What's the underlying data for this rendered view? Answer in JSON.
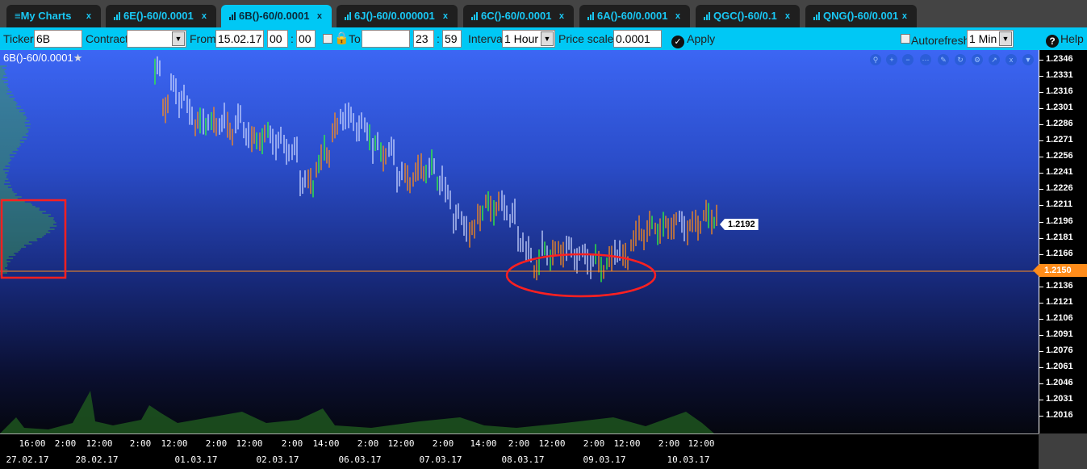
{
  "tabs": [
    {
      "label": "My Charts",
      "icon": "menu-icon"
    },
    {
      "label": "6E()-60/0.0001",
      "icon": "bar-chart-icon"
    },
    {
      "label": "6B()-60/0.0001",
      "icon": "bar-chart-icon",
      "active": true
    },
    {
      "label": "6J()-60/0.000001",
      "icon": "bar-chart-icon"
    },
    {
      "label": "6C()-60/0.0001",
      "icon": "bar-chart-icon"
    },
    {
      "label": "6A()-60/0.0001",
      "icon": "bar-chart-icon"
    },
    {
      "label": "QGC()-60/0.1",
      "icon": "bar-chart-icon"
    },
    {
      "label": "QNG()-60/0.001",
      "icon": "bar-chart-icon"
    }
  ],
  "close_symbol": "x",
  "toolbar": {
    "ticker_label": "Ticker",
    "ticker_value": "6B",
    "contract_label": "Contract",
    "contract_value": "",
    "from_label": "From",
    "from_date": "15.02.17",
    "from_hour": "00",
    "from_min": "00",
    "to_label": "To",
    "to_date": "",
    "to_hour": "23",
    "to_min": "59",
    "colon": ":",
    "interval_label": "Interval",
    "interval_value": "1 Hour",
    "price_scale_label": "Price scale",
    "price_scale_value": "0.0001",
    "apply_label": "Apply",
    "autorefresh_label": "Autorefresh",
    "autorefresh_value": "1 Min",
    "help_label": "Help"
  },
  "chart": {
    "title": "6B()-60/0.0001",
    "current_price": "1.2150",
    "last_bar_price": "1.2192",
    "colors": {
      "up": "#ff8c1a",
      "down": "#c8d4ff",
      "green": "#33ff33",
      "price_line": "#ff8c1a"
    }
  },
  "chart_data": {
    "type": "ohlc",
    "title": "6B()-60/0.0001",
    "y_ticks": [
      "1.2346",
      "1.2331",
      "1.2316",
      "1.2301",
      "1.2286",
      "1.2271",
      "1.2256",
      "1.2241",
      "1.2226",
      "1.2211",
      "1.2196",
      "1.2181",
      "1.2166",
      "1.2150",
      "1.2136",
      "1.2121",
      "1.2106",
      "1.2091",
      "1.2076",
      "1.2061",
      "1.2046",
      "1.2031",
      "1.2016"
    ],
    "ylim": [
      1.201,
      1.235
    ],
    "x_time_ticks": [
      "16:00",
      "2:00",
      "12:00",
      "2:00",
      "12:00",
      "2:00",
      "12:00",
      "2:00",
      "14:00",
      "2:00",
      "12:00",
      "2:00",
      "14:00",
      "2:00",
      "12:00",
      "2:00",
      "12:00",
      "2:00",
      "12:00"
    ],
    "x_date_ticks": [
      "27.02.17",
      "28.02.17",
      "01.03.17",
      "02.03.17",
      "06.03.17",
      "07.03.17",
      "08.03.17",
      "09.03.17",
      "10.03.17"
    ],
    "mid_prices": [
      1.2335,
      1.2305,
      1.232,
      1.231,
      1.23,
      1.2285,
      1.229,
      1.2285,
      1.229,
      1.228,
      1.229,
      1.228,
      1.227,
      1.2275,
      1.2275,
      1.227,
      1.2265,
      1.226,
      1.2235,
      1.223,
      1.225,
      1.226,
      1.228,
      1.2295,
      1.229,
      1.2285,
      1.228,
      1.2265,
      1.226,
      1.226,
      1.224,
      1.2235,
      1.224,
      1.2245,
      1.2245,
      1.2235,
      1.222,
      1.22,
      1.2195,
      1.2185,
      1.2205,
      1.221,
      1.221,
      1.221,
      1.22,
      1.218,
      1.2165,
      1.2155,
      1.217,
      1.2165,
      1.217,
      1.217,
      1.2165,
      1.2163,
      1.216,
      1.2155,
      1.2158,
      1.217,
      1.216,
      1.218,
      1.2185,
      1.219,
      1.219,
      1.219,
      1.2195,
      1.2195,
      1.219,
      1.2195,
      1.22,
      1.22
    ]
  }
}
